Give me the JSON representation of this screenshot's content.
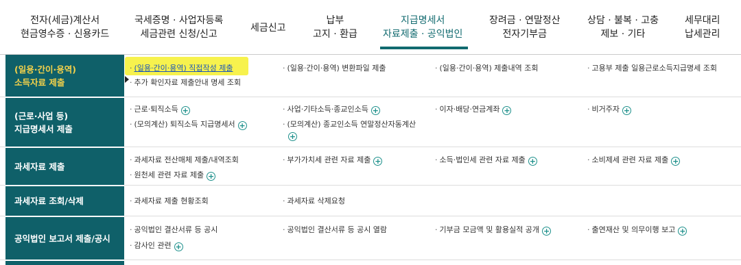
{
  "nav": {
    "items": [
      {
        "line1": "전자(세금)계산서",
        "line2": "현금영수증 · 신용카드"
      },
      {
        "line1": "국세증명 · 사업자등록",
        "line2": "세금관련 신청/신고"
      },
      {
        "line1": "세금신고",
        "line2": ""
      },
      {
        "line1": "납부",
        "line2": "고지 · 환급"
      },
      {
        "line1": "지급명세서",
        "line2": "자료제출 · 공익법인"
      },
      {
        "line1": "장려금 · 연말정산",
        "line2": "전자기부금"
      },
      {
        "line1": "상담 · 불복 · 고충",
        "line2": "제보 · 기타"
      },
      {
        "line1": "세무대리",
        "line2": "납세관리"
      }
    ],
    "active_index": 4,
    "accent_color": "#116a6f"
  },
  "rows": [
    {
      "head1": "(일용·간이·용역)",
      "head2": "소득자료 제출",
      "items": [
        {
          "label": "(일용·간이·용역) 직접작성 제출"
        },
        {
          "label": "(일용·간이·용역) 변환파일 제출"
        },
        {
          "label": "(일용·간이·용역) 제출내역 조회"
        },
        {
          "label": "고용부 제출 일용근로소득지급명세 조회"
        },
        {
          "label": "추가 확인자료 제출안내 명세 조회"
        }
      ]
    },
    {
      "head1": "(근로·사업 등)",
      "head2": "지급명세서 제출",
      "items": [
        {
          "label": "근로·퇴직소득"
        },
        {
          "label": "사업·기타소득·종교인소득"
        },
        {
          "label": "이자·배당·연금계좌"
        },
        {
          "label": "비거주자"
        },
        {
          "label": "(모의계산) 퇴직소득 지급명세서"
        },
        {
          "label": "(모의계산) 종교인소득 연말정산자동계산"
        }
      ]
    },
    {
      "head1": "과세자료 제출",
      "head2": "",
      "items": [
        {
          "label": "과세자료 전산매체 제출/내역조회"
        },
        {
          "label": "부가가치세 관련 자료 제출"
        },
        {
          "label": "소득·법인세 관련 자료 제출"
        },
        {
          "label": "소비제세 관련 자료 제출"
        },
        {
          "label": "원천세 관련 자료 제출"
        }
      ]
    },
    {
      "head1": "과세자료 조회/삭제",
      "head2": "",
      "items": [
        {
          "label": "과세자료 제출 현황조회"
        },
        {
          "label": "과세자료 삭제요청"
        }
      ]
    },
    {
      "head1": "공익법인 보고서 제출/공시",
      "head2": "",
      "items": [
        {
          "label": "공익법인 결산서류 등 공시"
        },
        {
          "label": "공익법인 결산서류 등 공시 열람"
        },
        {
          "label": "기부금 모금액 및 활용실적 공개"
        },
        {
          "label": "출연재산 및 의무이행 보고"
        },
        {
          "label": "감사인 관련"
        }
      ]
    }
  ],
  "colors": {
    "row_head_bg": "#0f6069",
    "active_head_text": "#f5d24a",
    "highlight": "#f6f13a",
    "plus_icon": "#1b8f8a"
  }
}
